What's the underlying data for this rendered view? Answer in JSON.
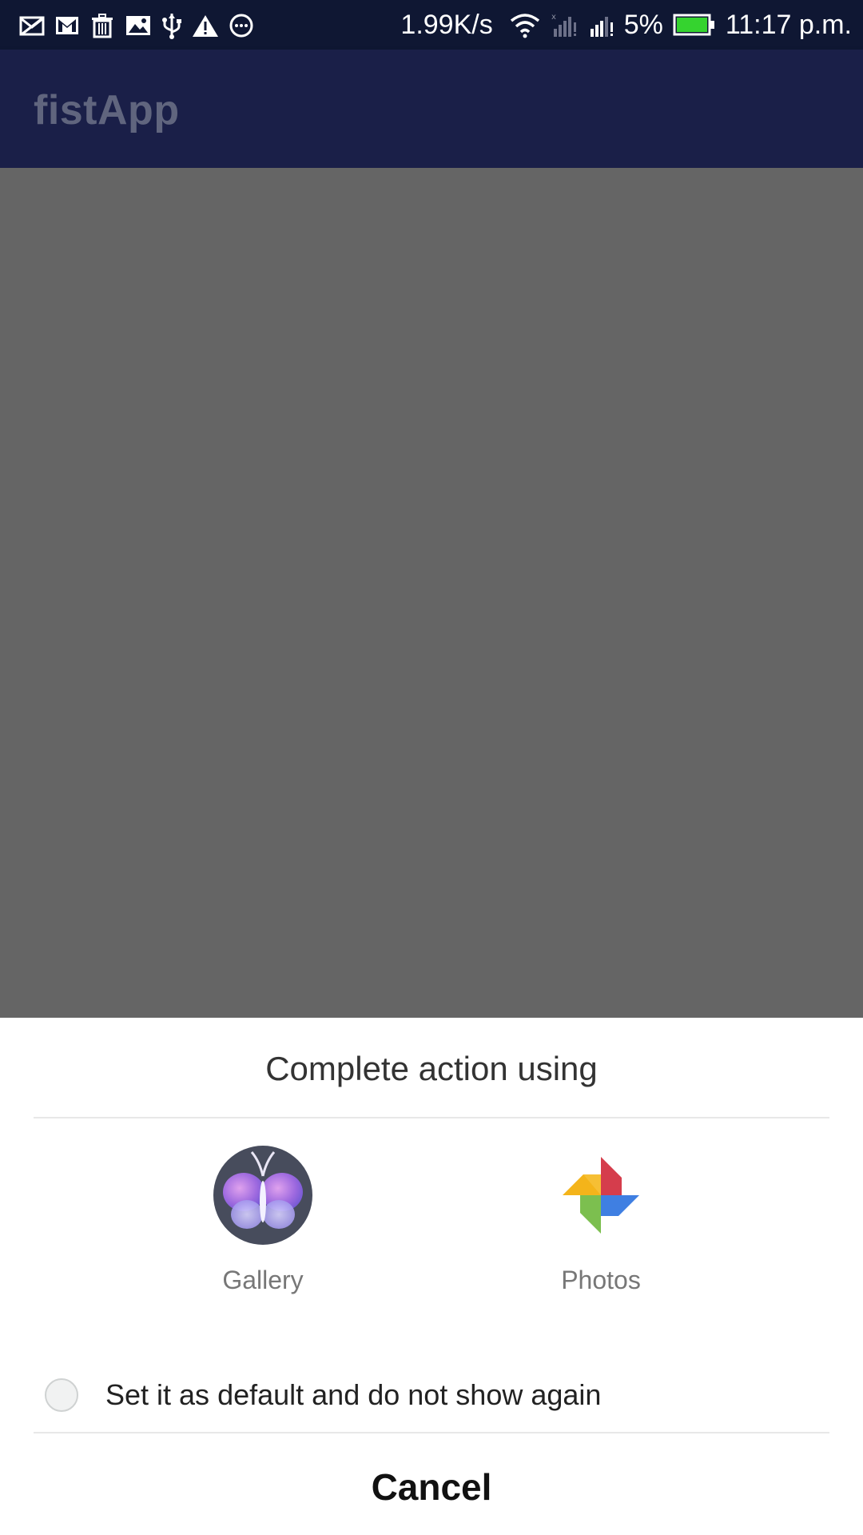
{
  "status_bar": {
    "icons_left": [
      "mail-blocked-icon",
      "gmail-icon",
      "trash-icon",
      "image-icon",
      "usb-icon",
      "warning-icon",
      "more-icon"
    ],
    "net_speed": "1.99K/s",
    "battery_percent": "5%",
    "battery_level": 0.05,
    "time": "11:17 p.m.",
    "battery_color": "#35d32f"
  },
  "app_bar": {
    "title": "fistApp",
    "background": "#1a1f48"
  },
  "dialog": {
    "title": "Complete action using",
    "apps": [
      {
        "label": "Gallery",
        "icon": "gallery-butterfly-icon"
      },
      {
        "label": "Photos",
        "icon": "google-photos-pinwheel-icon"
      }
    ],
    "default_option": {
      "label": "Set it as default and do not show again",
      "checked": false
    },
    "cancel_label": "Cancel"
  }
}
